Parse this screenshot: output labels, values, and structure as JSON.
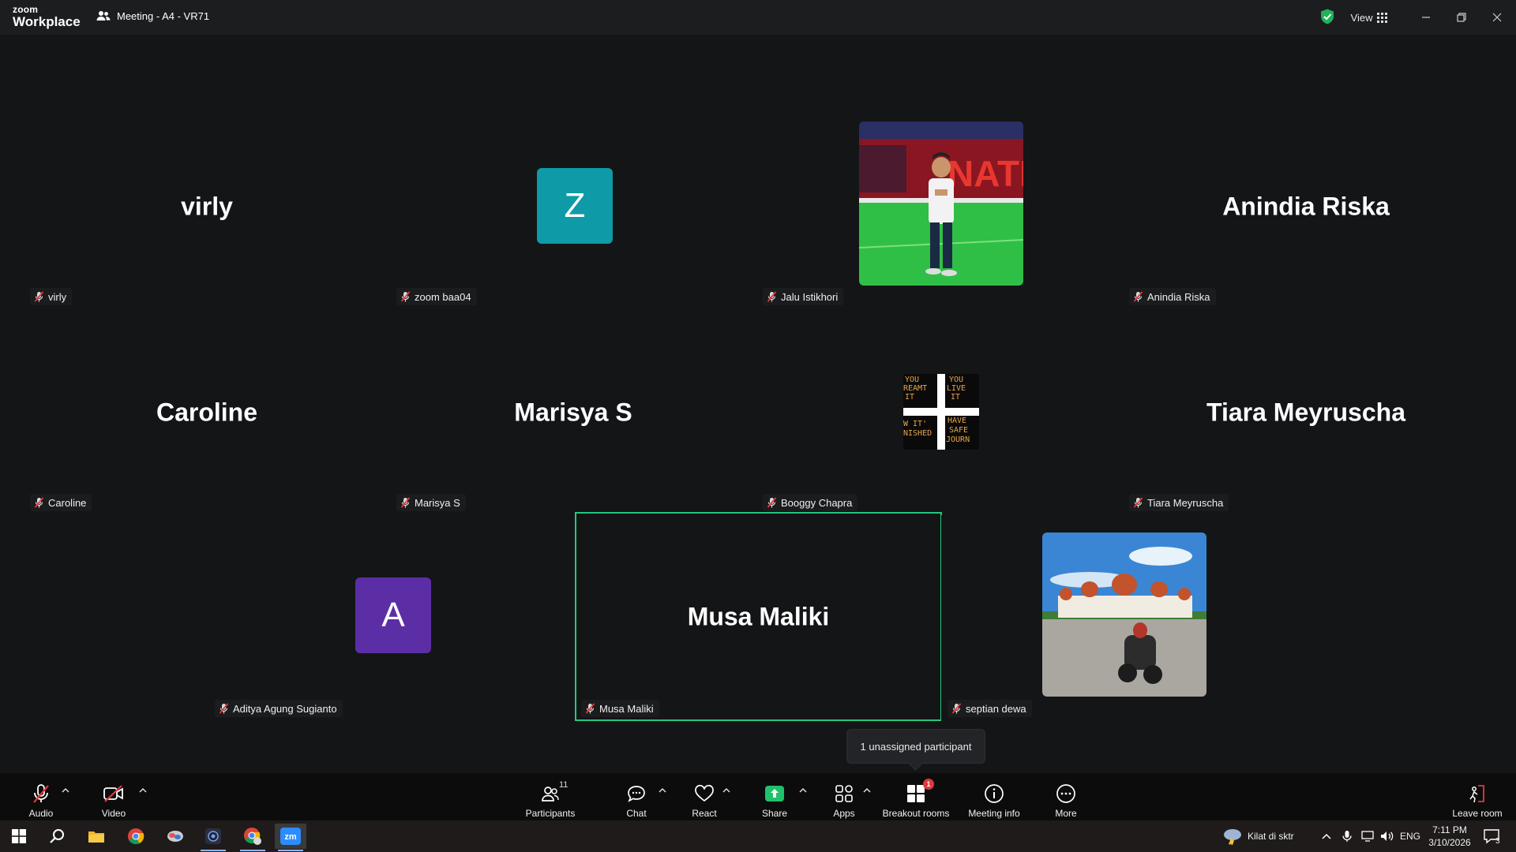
{
  "titlebar": {
    "logo_line1": "zoom",
    "logo_line2": "Workplace",
    "meeting_title": "Meeting - A4 - VR71",
    "view_label": "View"
  },
  "participants": [
    {
      "center_name": "virly",
      "label": "virly",
      "display": "name"
    },
    {
      "center_name": "",
      "label": "zoom baa04",
      "display": "avatar",
      "avatar_letter": "Z",
      "avatar_color": "#0e9aa7"
    },
    {
      "center_name": "",
      "label": "Jalu Istikhori",
      "display": "photo"
    },
    {
      "center_name": "Anindia Riska",
      "label": "Anindia Riska",
      "display": "name"
    },
    {
      "center_name": "Caroline",
      "label": "Caroline",
      "display": "name"
    },
    {
      "center_name": "Marisya S",
      "label": "Marisya S",
      "display": "name"
    },
    {
      "center_name": "",
      "label": "Booggy Chapra",
      "display": "photo",
      "photo_text": [
        "YOU DREAMT IT",
        "YOU LIVED IT",
        "NOW IT'S FINISHED",
        "HAVE A SAFE JOURNEY"
      ]
    },
    {
      "center_name": "Tiara Meyruscha",
      "label": "Tiara Meyruscha",
      "display": "name"
    },
    {
      "center_name": "",
      "label": "Aditya Agung Sugianto",
      "display": "avatar",
      "avatar_letter": "A",
      "avatar_color": "#5b2ea6"
    },
    {
      "center_name": "Musa Maliki",
      "label": "Musa Maliki",
      "display": "name",
      "active_speaker": true
    },
    {
      "center_name": "",
      "label": "septian dewa",
      "display": "photo"
    }
  ],
  "tooltip": "1 unassigned participant",
  "toolbar": {
    "audio": "Audio",
    "video": "Video",
    "participants": "Participants",
    "participants_count": "11",
    "chat": "Chat",
    "react": "React",
    "share": "Share",
    "apps": "Apps",
    "breakout": "Breakout rooms",
    "breakout_badge": "1",
    "meeting_info": "Meeting info",
    "more": "More",
    "leave": "Leave room"
  },
  "taskbar": {
    "weather": "Kilat di sktr",
    "lang": "ENG",
    "time": "7:11 PM",
    "date": "3/10/2026",
    "notif_count": "3"
  },
  "colors": {
    "accent_green": "#24c77e",
    "share_green": "#1fc26a",
    "badge_red": "#e0383e",
    "mic_off_red": "#e0383e"
  }
}
